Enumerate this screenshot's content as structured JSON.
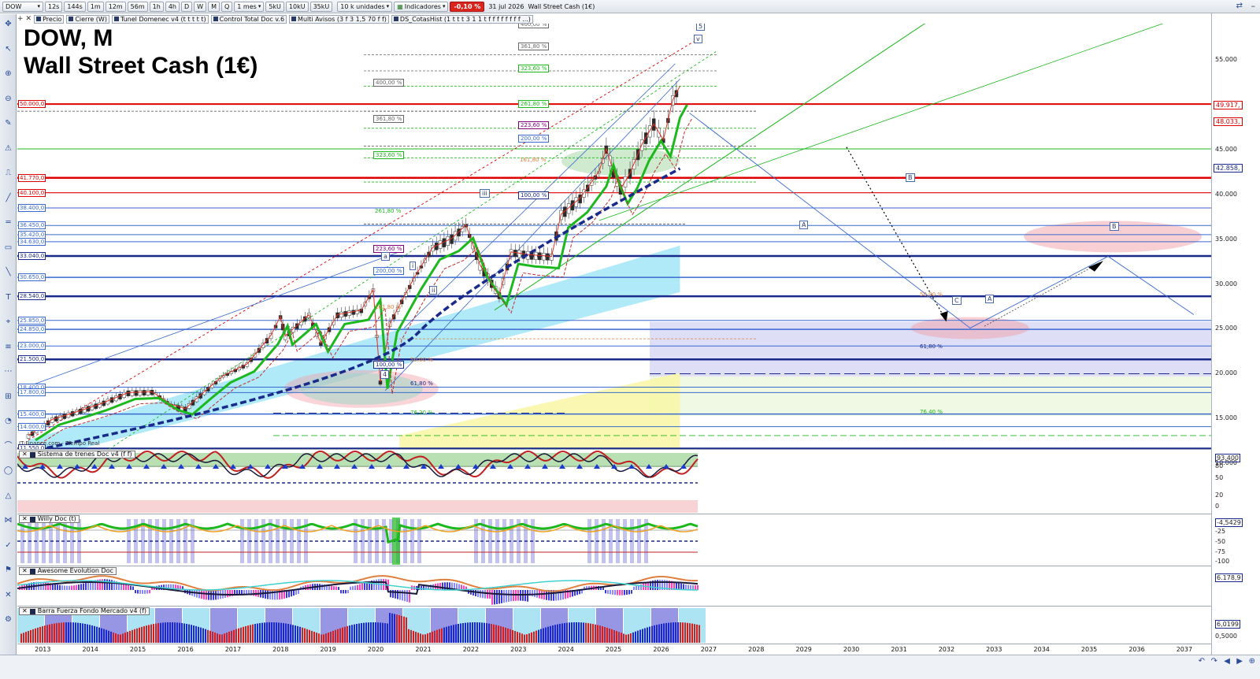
{
  "toolbar": {
    "symbol": "DOW",
    "periods": [
      "12s",
      "144s",
      "1m",
      "12m",
      "56m",
      "1h",
      "4h",
      "D",
      "W",
      "M",
      "Q"
    ],
    "interval": "1 mes",
    "units_a": "5kU",
    "units_b": "10kU",
    "units_c": "35kU",
    "units_select": "10 k unidades",
    "indicators": "Indicadores",
    "change": "-0,10 %",
    "date": "31 jul 2026",
    "instrument": "Wall Street Cash (1€)"
  },
  "tabs": [
    "Precio",
    "Cierre (W)",
    "Tunel Domenec v4 (t t t t t)",
    "Control Total Doc v.6",
    "Multi Avisos (3 f 3 1,5 70 f f)",
    "DS_CotasHist (1 t t t 3 1 1 t f f f f f f f f ...)"
  ],
  "chart": {
    "title_line1": "DOW, M",
    "title_line2": "Wall Street Cash (1€)",
    "source": "IT-Finance.com - Tiempo Real",
    "y_axis": [
      "55.000",
      "50.000",
      "45.000",
      "40.000",
      "35.000",
      "30.000",
      "25.000",
      "20.000",
      "15.000",
      "10.000"
    ],
    "price_boxes": [
      {
        "text": "49.917,",
        "color": "#d00"
      },
      {
        "text": "48.033,",
        "color": "#d00"
      },
      {
        "text": "42.858,",
        "color": "#1a2a8a"
      }
    ],
    "left_levels": [
      "50.000,0",
      "41.770,0",
      "40.100,0",
      "38.400,0",
      "36.450,0",
      "35.420,0",
      "34.630,0",
      "33.040,0",
      "30.650,0",
      "28.540,0",
      "25.850,0",
      "24.850,0",
      "23.000,0",
      "21.500,0",
      "18.400,0",
      "17.800,0",
      "15.400,0",
      "14.000,0",
      "11.550,0"
    ],
    "fib_labels": [
      "400,00 %",
      "361,80 %",
      "323,60 %",
      "400,00 %",
      "261,80 %",
      "361,80 %",
      "223,60 %",
      "200,00 %",
      "323,60 %",
      "161,80 %",
      "100,00 %",
      "261,80 %",
      "223,60 %",
      "200,00 %",
      "161,80 %",
      "100,00 %",
      "50,00 %",
      "61,80 %",
      "76,20 %",
      "50,00 %",
      "61,80 %",
      "76,40 %"
    ],
    "wave_labels": [
      "5",
      "v",
      "iii",
      "i",
      "ii",
      "a",
      "4",
      "B",
      "A",
      "C",
      "A",
      "B"
    ]
  },
  "panes": [
    {
      "title": "Sistema de trenes Doc v4 (f f)",
      "axis": [
        "93,400",
        "80",
        "50",
        "20",
        "0"
      ]
    },
    {
      "title": "Willy Doc (t)",
      "axis": [
        "-4,5429",
        "-25",
        "-50",
        "-75",
        "-100"
      ]
    },
    {
      "title": "Awesome Evolution Doc",
      "axis": [
        "6.178,9"
      ]
    },
    {
      "title": "Barra Fuerza Fondo Mercado v4 (f)",
      "axis": [
        "6,0199",
        "0,5000"
      ]
    }
  ],
  "x_axis": [
    "2013",
    "2014",
    "2015",
    "2016",
    "2017",
    "2018",
    "2019",
    "2020",
    "2021",
    "2022",
    "2023",
    "2024",
    "2025",
    "2026",
    "2027",
    "2028",
    "2029",
    "2030",
    "2031",
    "2032",
    "2033",
    "2034",
    "2035",
    "2036",
    "2037"
  ],
  "colors": {
    "support_red": "#e00000",
    "support_blue": "#1a2a8a",
    "ma_green": "#1db81d",
    "ma_blue": "#1a2a8a",
    "channel_cyan": "#5fd3f0",
    "zone_purple": "#c8c8f0",
    "zone_pink": "#f5b8c0"
  }
}
